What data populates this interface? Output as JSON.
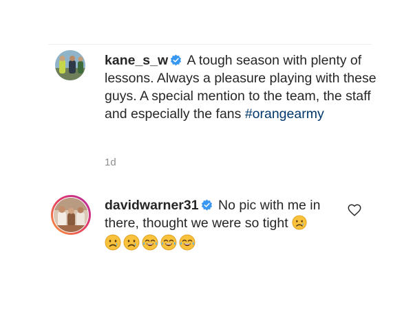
{
  "comments": [
    {
      "username": "kane_s_w",
      "verified": true,
      "text": "A tough season with plenty of lessons. Always a pleasure playing with these guys. A special mention to the team, the staff and especially the fans",
      "hashtag": "#orangearmy",
      "age": "1d"
    },
    {
      "username": "davidwarner31",
      "verified": true,
      "text": "No pic with me in there, thought we were so tight",
      "trailing_emoji": "sad-tear-face",
      "emoji_row": [
        "sad-tear-face",
        "sad-tear-face",
        "tears-of-joy-face",
        "tears-of-joy-face",
        "tears-of-joy-face"
      ],
      "has_story_ring": true,
      "like_icon": "heart-outline-icon"
    }
  ],
  "colors": {
    "verified_badge": "#3897f0",
    "hashtag": "#00376b",
    "text": "#262626",
    "secondary_text": "#8e8e8e",
    "story_ring_start": "#f9a03c",
    "story_ring_end": "#b624a4"
  }
}
